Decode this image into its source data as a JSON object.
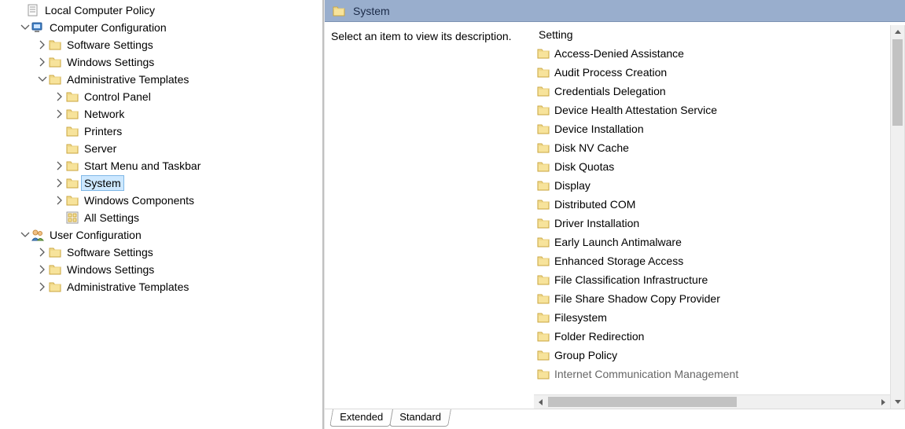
{
  "tree": {
    "root": {
      "label": "Local Computer Policy",
      "expander": "none",
      "icon": "policy-doc-icon"
    },
    "computer_config": {
      "label": "Computer Configuration",
      "expander": "open",
      "icon": "computer-icon",
      "children": {
        "software": {
          "label": "Software Settings",
          "expander": "closed",
          "icon": "folder-icon"
        },
        "windows": {
          "label": "Windows Settings",
          "expander": "closed",
          "icon": "folder-icon"
        },
        "admin_templates": {
          "label": "Administrative Templates",
          "expander": "open",
          "icon": "folder-icon",
          "children": {
            "control_panel": {
              "label": "Control Panel",
              "expander": "closed",
              "icon": "folder-icon"
            },
            "network": {
              "label": "Network",
              "expander": "closed",
              "icon": "folder-icon"
            },
            "printers": {
              "label": "Printers",
              "expander": "none",
              "icon": "folder-icon"
            },
            "server": {
              "label": "Server",
              "expander": "none",
              "icon": "folder-icon"
            },
            "start_menu": {
              "label": "Start Menu and Taskbar",
              "expander": "closed",
              "icon": "folder-icon"
            },
            "system": {
              "label": "System",
              "expander": "closed",
              "icon": "folder-icon",
              "selected": true
            },
            "win_components": {
              "label": "Windows Components",
              "expander": "closed",
              "icon": "folder-icon"
            },
            "all_settings": {
              "label": "All Settings",
              "expander": "none",
              "icon": "all-settings-icon"
            }
          }
        }
      }
    },
    "user_config": {
      "label": "User Configuration",
      "expander": "open",
      "icon": "user-icon",
      "children": {
        "software": {
          "label": "Software Settings",
          "expander": "closed",
          "icon": "folder-icon"
        },
        "windows": {
          "label": "Windows Settings",
          "expander": "closed",
          "icon": "folder-icon"
        },
        "admin_templates": {
          "label": "Administrative Templates",
          "expander": "closed",
          "icon": "folder-icon"
        }
      }
    }
  },
  "header": {
    "title": "System"
  },
  "description": {
    "text": "Select an item to view its description."
  },
  "list": {
    "column_header": "Setting",
    "items": [
      "Access-Denied Assistance",
      "Audit Process Creation",
      "Credentials Delegation",
      "Device Health Attestation Service",
      "Device Installation",
      "Disk NV Cache",
      "Disk Quotas",
      "Display",
      "Distributed COM",
      "Driver Installation",
      "Early Launch Antimalware",
      "Enhanced Storage Access",
      "File Classification Infrastructure",
      "File Share Shadow Copy Provider",
      "Filesystem",
      "Folder Redirection",
      "Group Policy",
      "Internet Communication Management"
    ]
  },
  "tabs": {
    "extended": "Extended",
    "standard": "Standard",
    "active": "extended"
  }
}
